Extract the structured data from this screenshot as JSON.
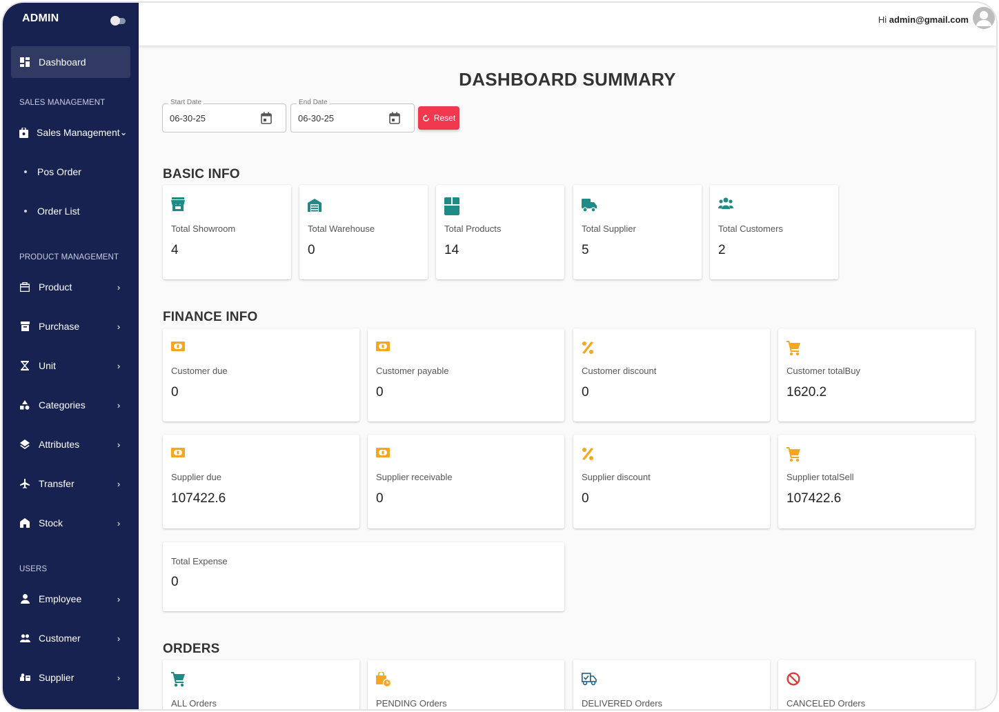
{
  "sidebar": {
    "brand": "ADMIN",
    "dashboard": "Dashboard",
    "sales_section": "SALES MANAGEMENT",
    "sales_management": "Sales Management",
    "pos_order": "Pos Order",
    "order_list": "Order List",
    "product_section": "PRODUCT MANAGEMENT",
    "product": "Product",
    "purchase": "Purchase",
    "unit": "Unit",
    "categories": "Categories",
    "attributes": "Attributes",
    "transfer": "Transfer",
    "stock": "Stock",
    "users_section": "USERS",
    "employee": "Employee",
    "customer": "Customer",
    "supplier": "Supplier"
  },
  "topbar": {
    "greeting_prefix": "Hi",
    "email": "admin@gmail.com"
  },
  "page": {
    "title": "DASHBOARD SUMMARY"
  },
  "filters": {
    "start_label": "Start Date",
    "start_value": "06-30-25",
    "end_label": "End Date",
    "end_value": "06-30-25",
    "reset_label": "Reset"
  },
  "basic_info": {
    "title": "BASIC INFO",
    "cards": [
      {
        "label": "Total Showroom",
        "value": "4"
      },
      {
        "label": "Total Warehouse",
        "value": "0"
      },
      {
        "label": "Total Products",
        "value": "14"
      },
      {
        "label": "Total Supplier",
        "value": "5"
      },
      {
        "label": "Total Customers",
        "value": "2"
      }
    ]
  },
  "finance_info": {
    "title": "FINANCE INFO",
    "cards": [
      {
        "label": "Customer due",
        "value": "0"
      },
      {
        "label": "Customer payable",
        "value": "0"
      },
      {
        "label": "Customer discount",
        "value": "0"
      },
      {
        "label": "Customer totalBuy",
        "value": "1620.2"
      },
      {
        "label": "Supplier due",
        "value": "107422.6"
      },
      {
        "label": "Supplier receivable",
        "value": "0"
      },
      {
        "label": "Supplier discount",
        "value": "0"
      },
      {
        "label": "Supplier totalSell",
        "value": "107422.6"
      },
      {
        "label": "Total Expense",
        "value": "0"
      }
    ]
  },
  "orders": {
    "title": "ORDERS",
    "cards": [
      {
        "label": "ALL Orders"
      },
      {
        "label": "PENDING Orders"
      },
      {
        "label": "DELIVERED Orders"
      },
      {
        "label": "CANCELED Orders"
      }
    ]
  },
  "colors": {
    "sidebar_bg": "#172250",
    "teal_icon": "#1f8a86",
    "orange_icon": "#f5a623",
    "reset_red": "#f0394f",
    "cancel_red": "#e53935"
  }
}
